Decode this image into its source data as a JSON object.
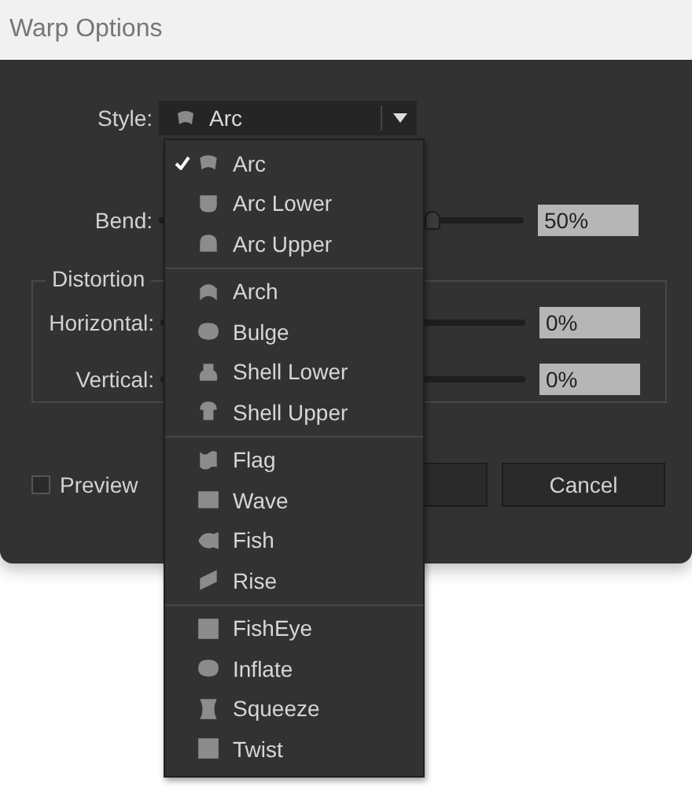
{
  "window": {
    "title": "Warp Options"
  },
  "style": {
    "label": "Style:",
    "value": "Arc"
  },
  "bend": {
    "label": "Bend:",
    "level": 0.75,
    "reading": "50%"
  },
  "distortion": {
    "title": "Distortion",
    "rows": [
      {
        "label": "Horizontal:",
        "reading": "0%"
      },
      {
        "label": "Vertical:",
        "reading": "0%"
      }
    ]
  },
  "preview": {
    "label": "Preview",
    "checked": false
  },
  "buttons": [
    {
      "label": "Cancel"
    }
  ],
  "menu": {
    "groups": [
      {
        "items": [
          {
            "label": "Arc",
            "selected": true
          },
          {
            "label": "Arc Lower",
            "selected": false
          },
          {
            "label": "Arc Upper",
            "selected": false
          }
        ]
      },
      {
        "items": [
          {
            "label": "Arch",
            "selected": false
          },
          {
            "label": "Bulge",
            "selected": false
          },
          {
            "label": "Shell Lower",
            "selected": false
          },
          {
            "label": "Shell Upper",
            "selected": false
          }
        ]
      },
      {
        "items": [
          {
            "label": "Flag",
            "selected": false
          },
          {
            "label": "Wave",
            "selected": false
          },
          {
            "label": "Fish",
            "selected": false
          },
          {
            "label": "Rise",
            "selected": false
          }
        ]
      },
      {
        "items": [
          {
            "label": "FishEye",
            "selected": false
          },
          {
            "label": "Inflate",
            "selected": false
          },
          {
            "label": "Squeeze",
            "selected": false
          },
          {
            "label": "Twist",
            "selected": false
          }
        ]
      }
    ]
  }
}
